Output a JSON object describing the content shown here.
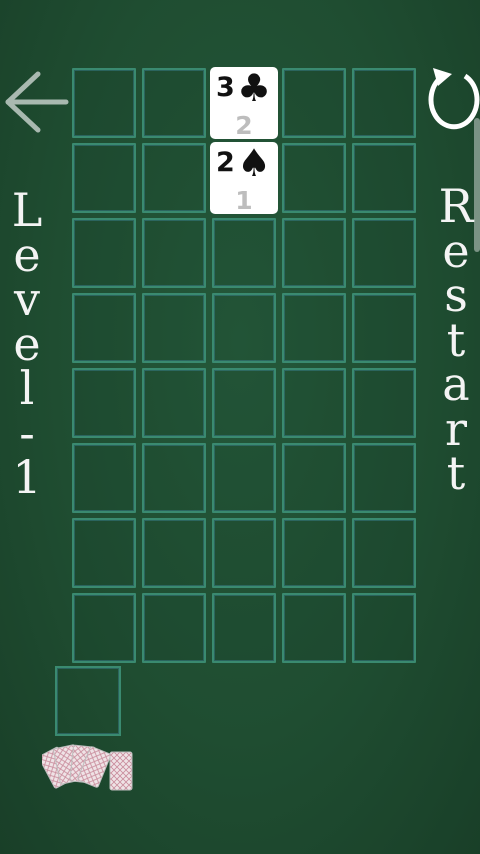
{
  "nav": {
    "back_icon": "left-arrow-icon",
    "restart_icon": "restart-icon"
  },
  "level_label": [
    "L",
    "e",
    "v",
    "e",
    "l",
    "-",
    "1"
  ],
  "restart_label": [
    "R",
    "e",
    "s",
    "t",
    "a",
    "r",
    "t"
  ],
  "board": {
    "columns": 5,
    "rows": 8
  },
  "cards": [
    {
      "rank": "3",
      "suit": "♣",
      "suit_name": "clubs",
      "number": "2",
      "col": 2,
      "row": 0
    },
    {
      "rank": "2",
      "suit": "♠",
      "suit_name": "spades",
      "number": "1",
      "col": 2,
      "row": 1
    }
  ],
  "deck_icon": "card-fan-icon",
  "colors": {
    "felt": "#1f4d31",
    "cell_border": "#3a8a70",
    "label": "#f4f4f4",
    "card": "#ffffff"
  }
}
